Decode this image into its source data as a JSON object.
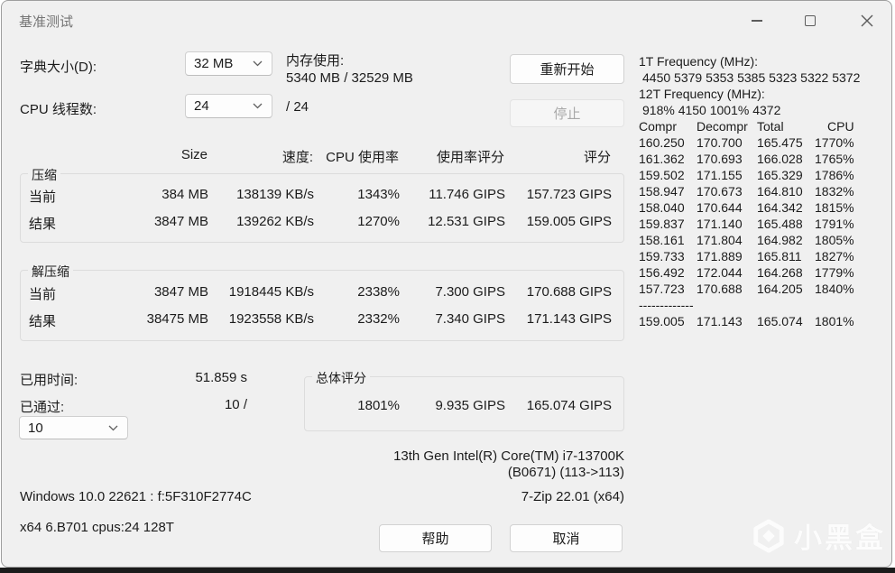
{
  "colors": {
    "window_bg": "#f0f0f0",
    "text": "#1b1b1b",
    "disabled_text": "#a8a8a8",
    "title_text": "#757575",
    "bottom_strip": "#1b1b1b"
  },
  "window": {
    "title": "基准测试"
  },
  "controls": {
    "dict_label": "字典大小(D):",
    "dict_value": "32 MB",
    "mem_label": "内存使用:",
    "mem_value": "5340 MB / 32529 MB",
    "threads_label": "CPU 线程数:",
    "threads_value": "24",
    "threads_suffix": "/ 24",
    "restart_button": "重新开始",
    "stop_button": "停止"
  },
  "freq_panel": {
    "line1": "1T Frequency (MHz):",
    "line2": "4450 5379 5353 5385 5323 5322 5372",
    "line3": "12T Frequency (MHz):",
    "line4": "918% 4150 1001% 4372",
    "header": [
      "Compr",
      "Decompr",
      "Total",
      "CPU"
    ],
    "rows": [
      [
        "160.250",
        "170.700",
        "165.475",
        "1770%"
      ],
      [
        "161.362",
        "170.693",
        "166.028",
        "1765%"
      ],
      [
        "159.502",
        "171.155",
        "165.329",
        "1786%"
      ],
      [
        "158.947",
        "170.673",
        "164.810",
        "1832%"
      ],
      [
        "158.040",
        "170.644",
        "164.342",
        "1815%"
      ],
      [
        "159.837",
        "171.140",
        "165.488",
        "1791%"
      ],
      [
        "158.161",
        "171.804",
        "164.982",
        "1805%"
      ],
      [
        "159.733",
        "171.889",
        "165.811",
        "1827%"
      ],
      [
        "156.492",
        "172.044",
        "164.268",
        "1779%"
      ],
      [
        "157.723",
        "170.688",
        "164.205",
        "1840%"
      ]
    ],
    "divider": "-------------",
    "total_row": [
      "159.005",
      "171.143",
      "165.074",
      "1801%"
    ]
  },
  "results_table": {
    "headers": [
      "Size",
      "速度:",
      "CPU 使用率",
      "使用率评分",
      "评分"
    ],
    "compression": {
      "label": "压缩",
      "rows": [
        {
          "label": "当前",
          "cells": [
            "384 MB",
            "138139 KB/s",
            "1343%",
            "11.746 GIPS",
            "157.723 GIPS"
          ]
        },
        {
          "label": "结果",
          "cells": [
            "3847 MB",
            "139262 KB/s",
            "1270%",
            "12.531 GIPS",
            "159.005 GIPS"
          ]
        }
      ]
    },
    "decompression": {
      "label": "解压缩",
      "rows": [
        {
          "label": "当前",
          "cells": [
            "3847 MB",
            "1918445 KB/s",
            "2338%",
            "7.300 GIPS",
            "170.688 GIPS"
          ]
        },
        {
          "label": "结果",
          "cells": [
            "38475 MB",
            "1923558 KB/s",
            "2332%",
            "7.340 GIPS",
            "171.143 GIPS"
          ]
        }
      ]
    }
  },
  "summary": {
    "elapsed_label": "已用时间:",
    "elapsed_value": "51.859 s",
    "passes_label": "已通过:",
    "passes_value": "10 /",
    "passes_dropdown_value": "10",
    "total_group_label": "总体评分",
    "total_values": [
      "1801%",
      "9.935 GIPS",
      "165.074 GIPS"
    ]
  },
  "footer": {
    "cpu_line1": "13th Gen Intel(R) Core(TM) i7-13700K",
    "cpu_line2": "(B0671) (113->113)",
    "os_line": "Windows 10.0 22621 :  f:5F310F2774C",
    "zip_version": "7-Zip 22.01 (x64)",
    "build_line": "x64 6.B701 cpus:24 128T",
    "help_button": "帮助",
    "cancel_button": "取消"
  },
  "watermark": {
    "text": "小黑盒"
  }
}
